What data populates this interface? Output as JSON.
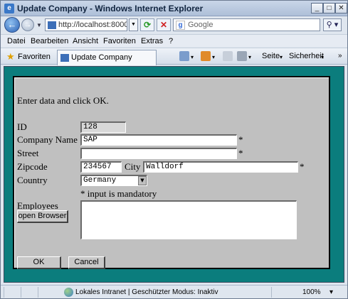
{
  "window": {
    "title": "Update Company - Windows Internet Explorer"
  },
  "address": {
    "url": "http://localhost:8000/",
    "search_placeholder": "Google"
  },
  "menu": [
    "Datei",
    "Bearbeiten",
    "Ansicht",
    "Favoriten",
    "Extras",
    "?"
  ],
  "favorites": {
    "label": "Favoriten",
    "tab_title": "Update Company"
  },
  "commands": {
    "page": "Seite",
    "security": "Sicherheit"
  },
  "form": {
    "instruction": "Enter data and click OK.",
    "id_label": "ID",
    "id_value": "128",
    "company_label": "Company Name",
    "company_value": "SAP",
    "street_label": "Street",
    "street_value": "",
    "zip_label": "Zipcode",
    "zip_value": "234567",
    "city_label": "City",
    "city_value": "Walldorf",
    "country_label": "Country",
    "country_value": "Germany",
    "mandatory_mark": "*",
    "mandatory_note": "* input is mandatory",
    "employees_label": "Employees",
    "open_browser_label": "open Browser",
    "ok_label": "OK",
    "cancel_label": "Cancel"
  },
  "status": {
    "text": "Lokales Intranet | Geschützter Modus: Inaktiv",
    "zoom": "100%"
  },
  "icons": [
    "ie-icon",
    "back-icon",
    "forward-icon",
    "refresh-icon",
    "stop-icon",
    "google-icon",
    "search-icon",
    "star-icon",
    "home-icon",
    "feeds-icon",
    "print-icon",
    "globe-icon"
  ]
}
